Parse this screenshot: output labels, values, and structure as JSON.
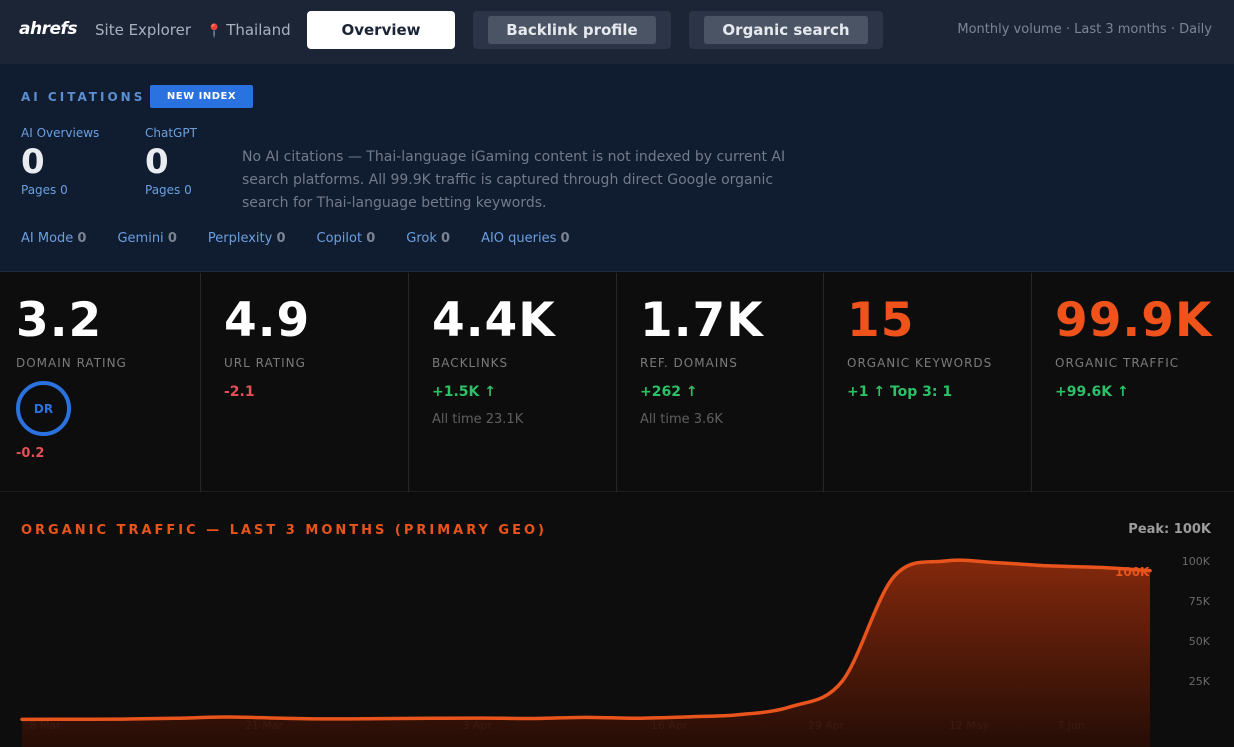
{
  "topbar": {
    "logo": "ahrefs",
    "tool": "Site Explorer",
    "geo": "Thailand",
    "tabs": [
      {
        "label": "Overview",
        "active": true
      },
      {
        "label": "Backlink profile",
        "active": false
      },
      {
        "label": "Organic search",
        "active": false
      }
    ],
    "meta": "Monthly volume · Last 3 months · Daily"
  },
  "ai_citations": {
    "title": "AI CITATIONS",
    "badge": "NEW INDEX",
    "columns": [
      {
        "label": "AI Overviews",
        "value": "0",
        "sub": "Pages 0"
      },
      {
        "label": "ChatGPT",
        "value": "0",
        "sub": "Pages 0"
      }
    ],
    "note": "No AI citations — Thai-language iGaming content is not indexed by current AI search platforms. All 99.9K traffic is captured through direct Google organic search for Thai-language betting keywords.",
    "platforms": [
      {
        "name": "AI Mode",
        "count": "0"
      },
      {
        "name": "Gemini",
        "count": "0"
      },
      {
        "name": "Perplexity",
        "count": "0"
      },
      {
        "name": "Copilot",
        "count": "0"
      },
      {
        "name": "Grok",
        "count": "0"
      },
      {
        "name": "AIO queries",
        "count": "0"
      }
    ]
  },
  "metrics": {
    "dr": {
      "value": "3.2",
      "label": "DOMAIN RATING",
      "badge": "DR",
      "change": "-0.2"
    },
    "ur": {
      "value": "4.9",
      "label": "URL RATING",
      "change": "-2.1"
    },
    "backlinks": {
      "value": "4.4K",
      "label": "BACKLINKS",
      "change": "+1.5K ↑",
      "alltime": "All time 23.1K"
    },
    "refdomains": {
      "value": "1.7K",
      "label": "REF. DOMAINS",
      "change": "+262 ↑",
      "alltime": "All time 3.6K"
    },
    "keywords": {
      "value": "15",
      "label": "ORGANIC KEYWORDS",
      "change": "+1 ↑ Top 3: 1"
    },
    "traffic": {
      "value": "99.9K",
      "label": "ORGANIC TRAFFIC",
      "change": "+99.6K ↑"
    }
  },
  "chart": {
    "title": "ORGANIC TRAFFIC — LAST 3 MONTHS (PRIMARY GEO)",
    "peak": "Peak: 100K",
    "end_label": "100K",
    "accent": "#e8541c"
  },
  "chart_data": {
    "type": "area",
    "x_tick_labels": [
      "8 Mar",
      "21 Mar",
      "3 Apr",
      "16 Apr",
      "29 Apr",
      "12 May",
      "7 Jun"
    ],
    "y_tick_labels": [
      "25K",
      "50K",
      "75K",
      "100K"
    ],
    "ylim": [
      0,
      110000
    ],
    "series": [
      {
        "values": [
          1000,
          1100,
          1200,
          1700,
          2500,
          1800,
          1300,
          1500,
          1700,
          1800,
          1600,
          2300,
          1700,
          2600,
          4000,
          9000,
          25000,
          90000,
          100000,
          99000,
          97000,
          96000,
          94000
        ]
      }
    ]
  }
}
